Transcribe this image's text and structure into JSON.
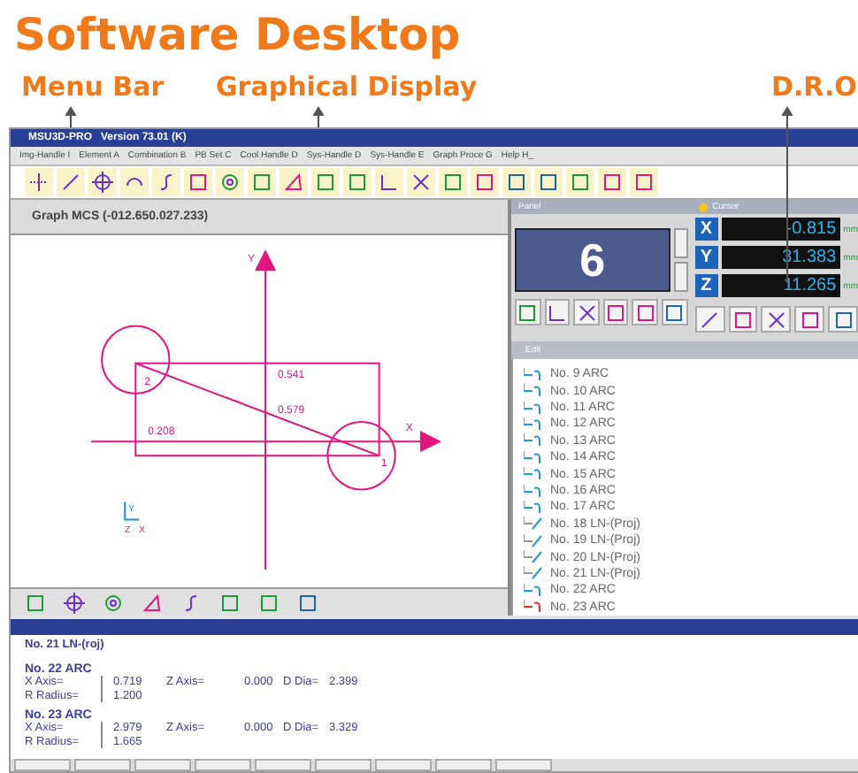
{
  "heading": "Software Desktop",
  "callouts": [
    {
      "label": "Menu Bar"
    },
    {
      "label": "Graphical Display"
    },
    {
      "label": "D.R.O"
    }
  ],
  "window": {
    "title": "MSU3D-PRO   Version 73.01 (K)"
  },
  "menu": [
    "Img-Handle I",
    "Element A",
    "Combination B",
    "PB Set C",
    "Cool Handle D",
    "Sys-Handle D",
    "Sys-Handle E",
    "Graph Proce G",
    "Help H_"
  ],
  "graph": {
    "title": "Graph MCS (-012.650.027.233)",
    "labels": [
      "0.541",
      "0.579",
      "0.208",
      "2",
      "1",
      "X",
      "Y"
    ],
    "mini_axes": [
      "Y",
      "Z",
      "X"
    ]
  },
  "panel": {
    "title": "Panel",
    "value": "6"
  },
  "cursor": {
    "title": "Cursor",
    "axes": [
      {
        "axis": "X",
        "value": "-0.815",
        "unit": "mm"
      },
      {
        "axis": "Y",
        "value": "31.383",
        "unit": "mm"
      },
      {
        "axis": "Z",
        "value": "11.265",
        "unit": "mm"
      }
    ]
  },
  "edit": {
    "title": "Edit",
    "items": [
      {
        "label": "No. 9  ARC",
        "kind": "arc",
        "selected": false
      },
      {
        "label": "No. 10  ARC",
        "kind": "arc",
        "selected": false
      },
      {
        "label": "No. 11 ARC",
        "kind": "arc",
        "selected": false
      },
      {
        "label": "No. 12 ARC",
        "kind": "arc",
        "selected": false
      },
      {
        "label": "No. 13 ARC",
        "kind": "arc",
        "selected": false
      },
      {
        "label": "No. 14 ARC",
        "kind": "arc",
        "selected": false
      },
      {
        "label": "No. 15 ARC",
        "kind": "arc",
        "selected": false
      },
      {
        "label": "No. 16 ARC",
        "kind": "arc",
        "selected": false
      },
      {
        "label": "No. 17 ARC",
        "kind": "arc",
        "selected": false
      },
      {
        "label": "No. 18 LN-(Proj)",
        "kind": "line",
        "selected": false
      },
      {
        "label": "No. 19 LN-(Proj)",
        "kind": "line",
        "selected": false
      },
      {
        "label": "No. 20 LN-(Proj)",
        "kind": "line",
        "selected": false
      },
      {
        "label": "No. 21 LN-(Proj)",
        "kind": "line",
        "selected": false
      },
      {
        "label": "No. 22  ARC",
        "kind": "arc",
        "selected": false
      },
      {
        "label": "No. 23  ARC",
        "kind": "arc",
        "selected": true
      }
    ]
  },
  "details": {
    "header": "No. 21  LN-(roj)",
    "entries": [
      {
        "title": "No. 22 ARC",
        "rows": [
          {
            "label": "X Axis=",
            "cells": [
              "0.719",
              "Z Axis=",
              "0.000",
              "D Dia=",
              "2.399"
            ]
          },
          {
            "label": "R Radius=",
            "cells": [
              "1.200"
            ]
          }
        ]
      },
      {
        "title": "No. 23 ARC",
        "rows": [
          {
            "label": "X Axis=",
            "cells": [
              "2.979",
              "Z Axis=",
              "0.000",
              "D Dia=",
              "3.329"
            ]
          },
          {
            "label": "R Radius=",
            "cells": [
              "1.665"
            ]
          }
        ]
      }
    ]
  }
}
